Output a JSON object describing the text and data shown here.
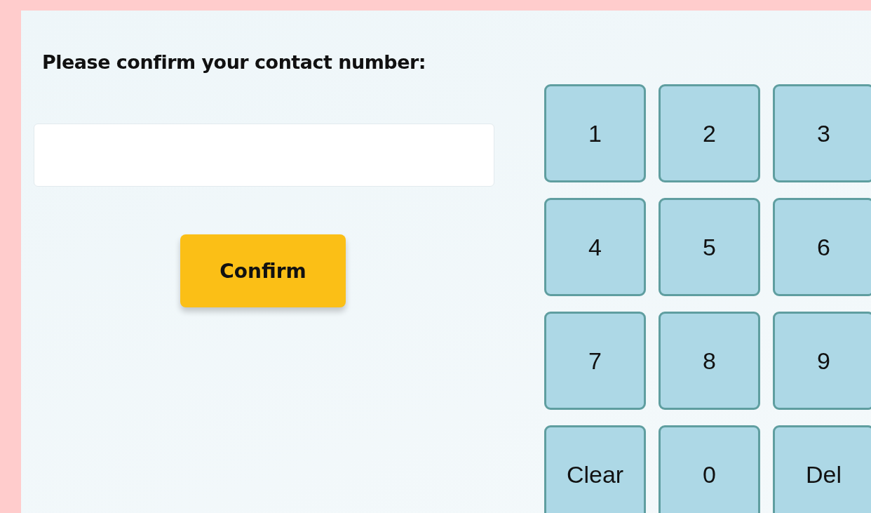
{
  "prompt": "Please confirm your contact number:",
  "confirm_button": "Confirm",
  "keypad": [
    "1",
    "2",
    "3",
    "4",
    "5",
    "6",
    "7",
    "8",
    "9",
    "Clear",
    "0",
    "Del"
  ]
}
